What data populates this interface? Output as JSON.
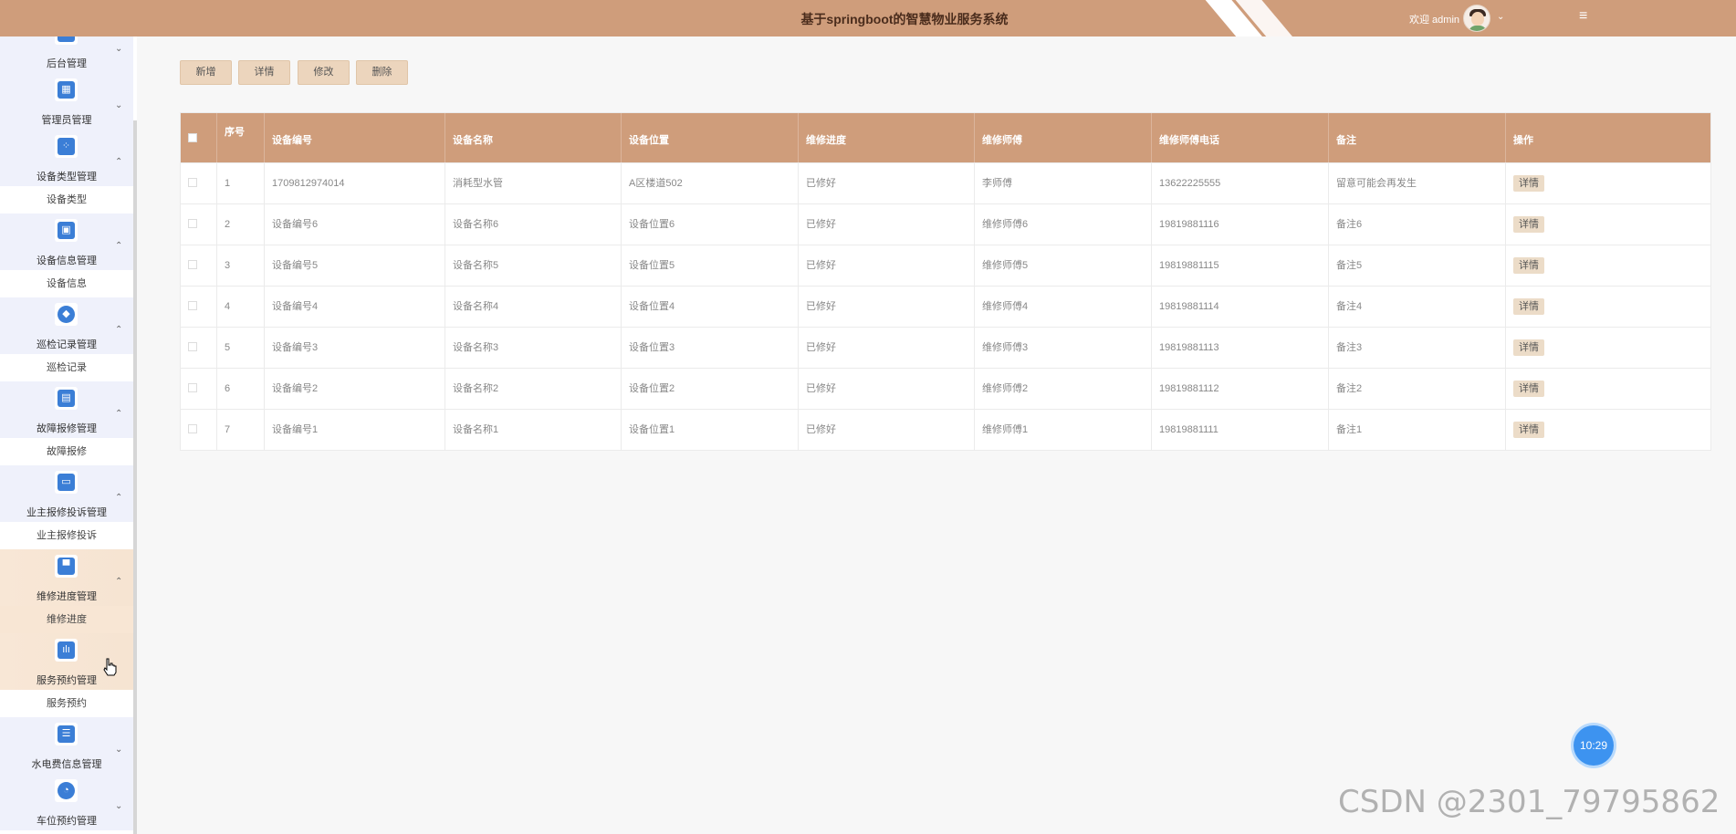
{
  "header": {
    "title": "基于springboot的智慧物业服务系统",
    "welcome": "欢迎 admin",
    "caret": "⌄",
    "menu_icon": "≡"
  },
  "sidebar": {
    "groups": [
      {
        "label": "后台管理",
        "icon": "■",
        "arrow": "⌄"
      },
      {
        "label": "管理员管理",
        "icon": "▦",
        "arrow": "⌄"
      },
      {
        "label": "设备类型管理",
        "icon": "⁘",
        "arrow": "⌃",
        "sub": "设备类型"
      },
      {
        "label": "设备信息管理",
        "icon": "▣",
        "arrow": "⌃",
        "sub": "设备信息"
      },
      {
        "label": "巡检记录管理",
        "icon": "◆",
        "arrow": "⌃",
        "sub": "巡检记录"
      },
      {
        "label": "故障报修管理",
        "icon": "▤",
        "arrow": "⌃",
        "sub": "故障报修"
      },
      {
        "label": "业主报修投诉管理",
        "icon": "▭",
        "arrow": "⌃",
        "sub": "业主报修投诉"
      },
      {
        "label": "维修进度管理",
        "icon": "▀",
        "arrow": "⌃",
        "sub": "维修进度"
      },
      {
        "label": "服务预约管理",
        "icon": "ılı",
        "arrow": "",
        "sub": "服务预约"
      },
      {
        "label": "水电费信息管理",
        "icon": "☰",
        "arrow": "⌄"
      },
      {
        "label": "车位预约管理",
        "icon": "◔",
        "arrow": "⌄"
      }
    ]
  },
  "toolbar": {
    "add": "新增",
    "detail": "详情",
    "edit": "修改",
    "delete": "删除"
  },
  "table": {
    "columns": [
      "序号",
      "设备编号",
      "设备名称",
      "设备位置",
      "维修进度",
      "维修师傅",
      "维修师傅电话",
      "备注",
      "操作"
    ],
    "action_label": "详情",
    "rows": [
      [
        "1",
        "1709812974014",
        "消耗型水管",
        "A区楼道502",
        "已修好",
        "李师傅",
        "13622225555",
        "留意可能会再发生"
      ],
      [
        "2",
        "设备编号6",
        "设备名称6",
        "设备位置6",
        "已修好",
        "维修师傅6",
        "19819881116",
        "备注6"
      ],
      [
        "3",
        "设备编号5",
        "设备名称5",
        "设备位置5",
        "已修好",
        "维修师傅5",
        "19819881115",
        "备注5"
      ],
      [
        "4",
        "设备编号4",
        "设备名称4",
        "设备位置4",
        "已修好",
        "维修师傅4",
        "19819881114",
        "备注4"
      ],
      [
        "5",
        "设备编号3",
        "设备名称3",
        "设备位置3",
        "已修好",
        "维修师傅3",
        "19819881113",
        "备注3"
      ],
      [
        "6",
        "设备编号2",
        "设备名称2",
        "设备位置2",
        "已修好",
        "维修师傅2",
        "19819881112",
        "备注2"
      ],
      [
        "7",
        "设备编号1",
        "设备名称1",
        "设备位置1",
        "已修好",
        "维修师傅1",
        "19819881111",
        "备注1"
      ]
    ]
  },
  "clock": "10:29",
  "watermark": "CSDN @2301_79795862",
  "colors": {
    "accent": "#cf9d7b",
    "button": "#ecd5bd",
    "icon": "#3b7ed6"
  }
}
